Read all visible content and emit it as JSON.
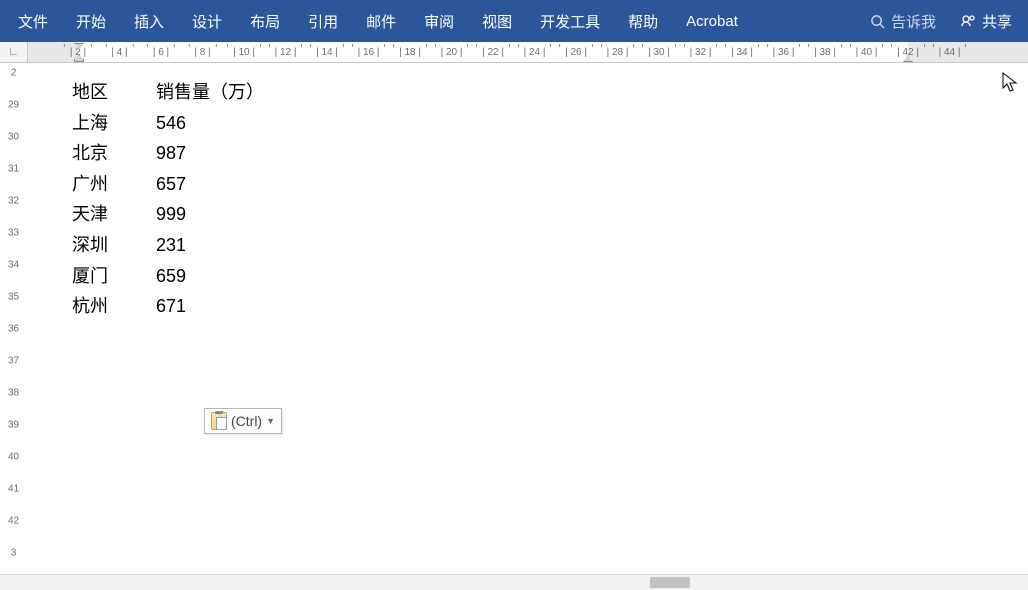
{
  "ribbon": {
    "tabs": [
      "文件",
      "开始",
      "插入",
      "设计",
      "布局",
      "引用",
      "邮件",
      "审阅",
      "视图",
      "开发工具",
      "帮助",
      "Acrobat"
    ],
    "tellme_placeholder": "告诉我",
    "share_label": "共享"
  },
  "h_ruler_labels": [
    "2",
    "4",
    "6",
    "8",
    "10",
    "12",
    "14",
    "16",
    "18",
    "20",
    "22",
    "24",
    "26",
    "28",
    "30",
    "32",
    "34",
    "36",
    "38",
    "40",
    "42",
    "44"
  ],
  "v_ruler_labels": [
    "2",
    "29",
    "30",
    "31",
    "32",
    "33",
    "34",
    "35",
    "36",
    "37",
    "38",
    "39",
    "40",
    "41",
    "42",
    "3"
  ],
  "document": {
    "header": {
      "region": "地区",
      "sales": "销售量（万）"
    },
    "rows": [
      {
        "region": "上海",
        "sales": "546"
      },
      {
        "region": "北京",
        "sales": "987"
      },
      {
        "region": "广州",
        "sales": "657"
      },
      {
        "region": "天津",
        "sales": "999"
      },
      {
        "region": "深圳",
        "sales": "231"
      },
      {
        "region": "厦门",
        "sales": "659"
      },
      {
        "region": "杭州",
        "sales": "671"
      }
    ]
  },
  "paste_options": {
    "label": "(Ctrl)"
  },
  "tab_stop_icon": "∟"
}
